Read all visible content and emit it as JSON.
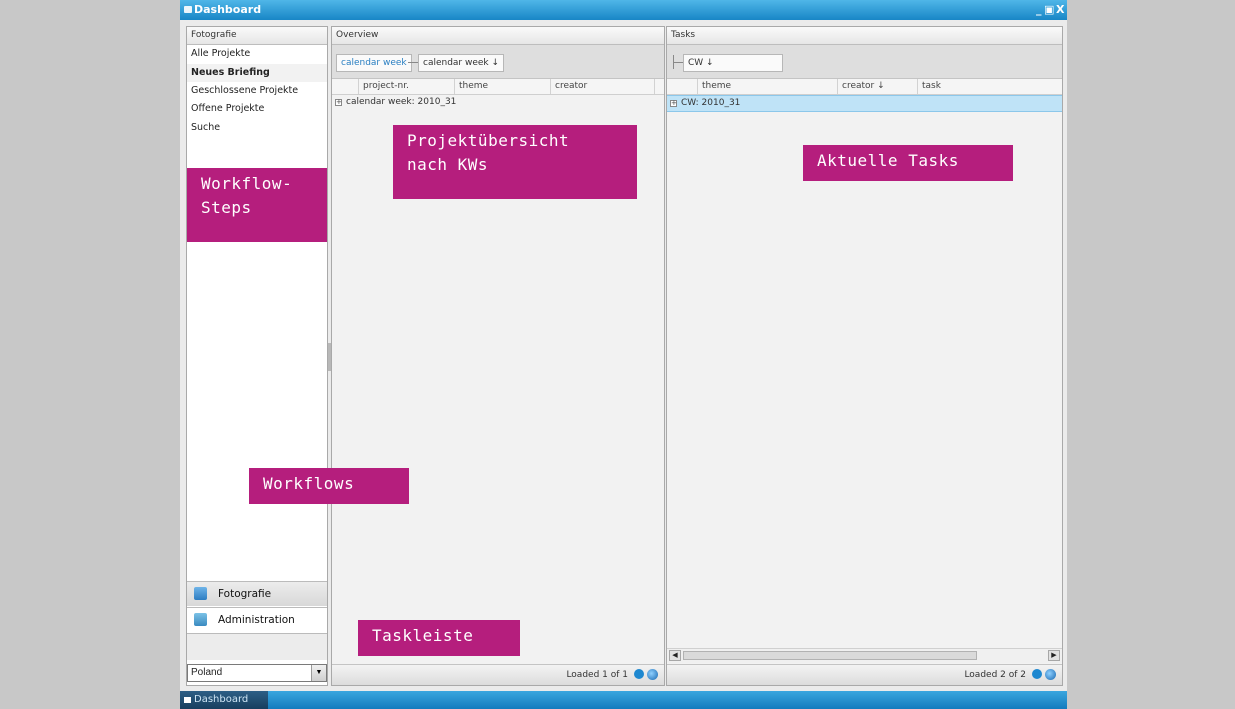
{
  "window": {
    "title": "Dashboard",
    "controls": [
      "_",
      "▣",
      "X"
    ]
  },
  "sidebar": {
    "header": "Fotografie",
    "items": [
      {
        "label": "Alle Projekte"
      },
      {
        "label": "Neues Briefing",
        "selected": true
      },
      {
        "label": "Geschlossene Projekte"
      },
      {
        "label": "Offene Projekte"
      },
      {
        "label": "Suche"
      }
    ],
    "accordion": [
      {
        "label": "Fotografie",
        "icon": "camera-icon"
      },
      {
        "label": "Administration",
        "icon": "admin-icon"
      }
    ],
    "country_select": "Poland"
  },
  "overview": {
    "header": "Overview",
    "group_chips": [
      "calendar week",
      "calendar week ↓"
    ],
    "columns": [
      "project-nr.",
      "theme",
      "creator"
    ],
    "group_row": "calendar week: 2010_31",
    "footer": "Loaded 1 of 1"
  },
  "tasks": {
    "header": "Tasks",
    "group_chips": [
      "CW ↓"
    ],
    "columns": [
      "theme",
      "creator ↓",
      "task"
    ],
    "group_row": "CW: 2010_31",
    "footer": "Loaded 2 of 2"
  },
  "annotations": {
    "workflow_steps": "Workflow-\nSteps",
    "projekt": "Projektübersicht\nnach KWs",
    "aktuelle": "Aktuelle Tasks",
    "workflows": "Workflows",
    "taskleiste": "Taskleiste"
  },
  "taskbar": {
    "button": "Dashboard"
  },
  "colors": {
    "accent": "#1886c6",
    "annotation": "#b51e7d",
    "selected_row": "#bfe3f7"
  }
}
